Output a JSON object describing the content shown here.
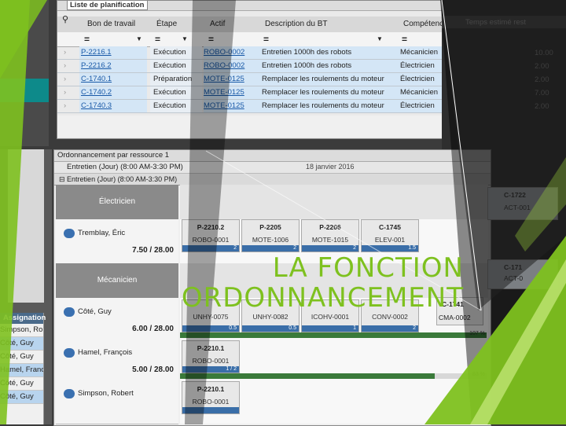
{
  "planning_list": {
    "title": "Liste de planification",
    "columns": [
      "Bon de travail",
      "Étape",
      "Actif",
      "Description du BT",
      "Compétence",
      "Temps estimé rest"
    ],
    "filter_symbol": "=",
    "rows": [
      {
        "wo": "P-2216.1",
        "step": "Exécution",
        "asset": "ROBO-0002",
        "desc": "Entretien 1000h des robots",
        "skill": "Mécanicien",
        "time": "10.00"
      },
      {
        "wo": "P-2216.2",
        "step": "Exécution",
        "asset": "ROBO-0002",
        "desc": "Entretien 1000h des robots",
        "skill": "Électricien",
        "time": "2.00"
      },
      {
        "wo": "C-1740.1",
        "step": "Préparation",
        "asset": "MOTE-0125",
        "desc": "Remplacer les roulements du moteur",
        "skill": "Électricien",
        "time": "2.00"
      },
      {
        "wo": "C-1740.2",
        "step": "Exécution",
        "asset": "MOTE-0125",
        "desc": "Remplacer les roulements du moteur",
        "skill": "Mécanicien",
        "time": "7.00"
      },
      {
        "wo": "C-1740.3",
        "step": "Exécution",
        "asset": "MOTE-0125",
        "desc": "Remplacer les roulements du moteur",
        "skill": "Électricien",
        "time": "2.00"
      }
    ]
  },
  "scheduling": {
    "title": "Ordonnancement par ressource 1",
    "view_label": "Entretien (Jour) (8:00 AM-3:30 PM)",
    "group_label": "Entretien (Jour) (8:00 AM-3:30 PM)",
    "date": "18 janvier 2016",
    "groups": [
      {
        "name": "Électricien",
        "resources": [
          {
            "name": "Tremblay, Éric",
            "hours": "7.50 / 28.00"
          }
        ]
      },
      {
        "name": "Mécanicien",
        "resources": [
          {
            "name": "Côté, Guy",
            "hours": "6.00 / 28.00"
          },
          {
            "name": "Hamel, François",
            "hours": "5.00 / 28.00"
          },
          {
            "name": "Simpson, Robert",
            "hours": ""
          }
        ]
      }
    ],
    "tasks_electricien": [
      {
        "wo": "P-2210.2",
        "asset": "ROBO-0001",
        "val": "2"
      },
      {
        "wo": "P-2205",
        "asset": "MOTE-1006",
        "val": "2"
      },
      {
        "wo": "P-2206",
        "asset": "MOTE-1015",
        "val": "2"
      },
      {
        "wo": "C-1745",
        "asset": "ELEV-001",
        "val": "1.5"
      }
    ],
    "tasks_cote": [
      {
        "asset": "UNHY-0075",
        "val": "0.5"
      },
      {
        "asset": "UNHY-0082",
        "val": "0.5"
      },
      {
        "asset": "ICOHV-0001",
        "val": "1"
      },
      {
        "asset": "CONV-0002",
        "val": "2"
      }
    ],
    "task_hamel": {
      "wo": "P-2210.1",
      "asset": "ROBO-0001",
      "val": "1 / 2"
    },
    "task_simpson": {
      "wo": "P-2210.1",
      "asset": "ROBO-0001"
    },
    "pct_cote": "107 %",
    "pct_hamel": "83 %",
    "right_cards": [
      {
        "wo": "C-1722",
        "asset": "ACT-001"
      },
      {
        "wo": "C-171",
        "asset": "ACT-0"
      }
    ],
    "card_c1741": "C-1741",
    "card_cma": "CMA-0002"
  },
  "assignation": {
    "title": "Assignation",
    "rows": [
      "Simpson, Ro",
      "Côté, Guy",
      "Côté, Guy",
      "Hamel, Franc",
      "Côté, Guy",
      "Côté, Guy"
    ]
  },
  "overlay": {
    "line1": "LA FONCTION",
    "line2": "ORDONNANCEMENT",
    "accent": "#7ec11f"
  }
}
